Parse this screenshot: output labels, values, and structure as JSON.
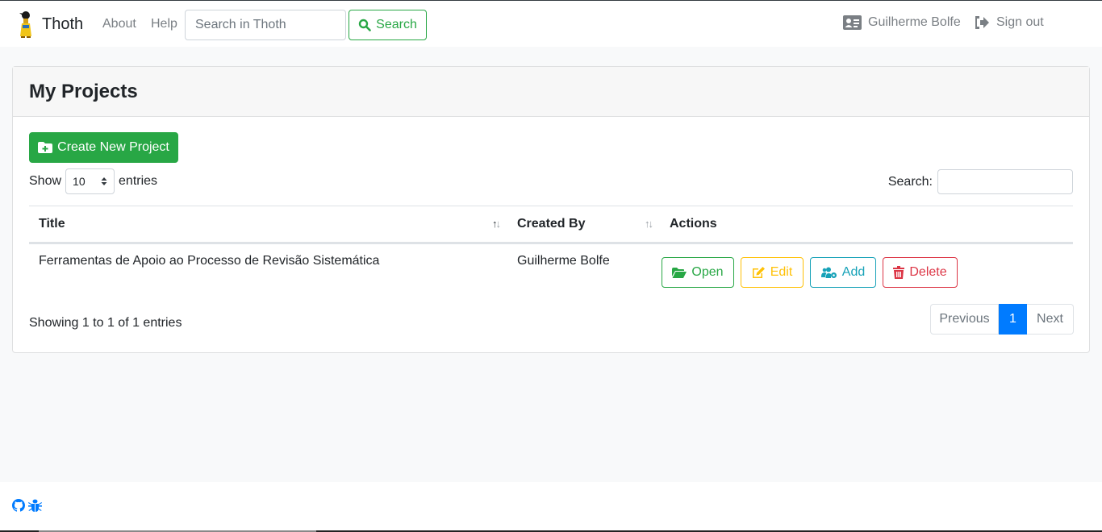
{
  "navbar": {
    "brand": "Thoth",
    "links": {
      "about": "About",
      "help": "Help"
    },
    "search": {
      "placeholder": "Search in Thoth",
      "button_label": "Search"
    },
    "user": {
      "name": "Guilherme Bolfe",
      "signout": "Sign out"
    }
  },
  "card": {
    "title": "My Projects",
    "create_button": "Create New Project",
    "length": {
      "prefix": "Show",
      "value": "10",
      "suffix": "entries"
    },
    "search_label": "Search:"
  },
  "table": {
    "columns": [
      "Title",
      "Created By",
      "Actions"
    ],
    "rows": [
      {
        "title": "Ferramentas de Apoio ao Processo de Revisão Sistemática",
        "created_by": "Guilherme Bolfe",
        "actions": {
          "open": "Open",
          "edit": "Edit",
          "add": "Add",
          "delete": "Delete"
        }
      }
    ]
  },
  "info": "Showing 1 to 1 of 1 entries",
  "pagination": {
    "previous": "Previous",
    "current": "1",
    "next": "Next"
  },
  "colors": {
    "success": "#28a745",
    "warning": "#ffc107",
    "info": "#17a2b8",
    "danger": "#dc3545",
    "primary": "#007bff"
  },
  "icons": {
    "search": "search-icon",
    "user": "id-card-icon",
    "signout": "sign-out-icon",
    "folder_plus": "folder-plus-icon",
    "folder_open": "folder-open-icon",
    "edit": "edit-icon",
    "add": "users-cog-icon",
    "delete": "trash-icon",
    "github": "github-icon",
    "bug": "bug-icon"
  }
}
